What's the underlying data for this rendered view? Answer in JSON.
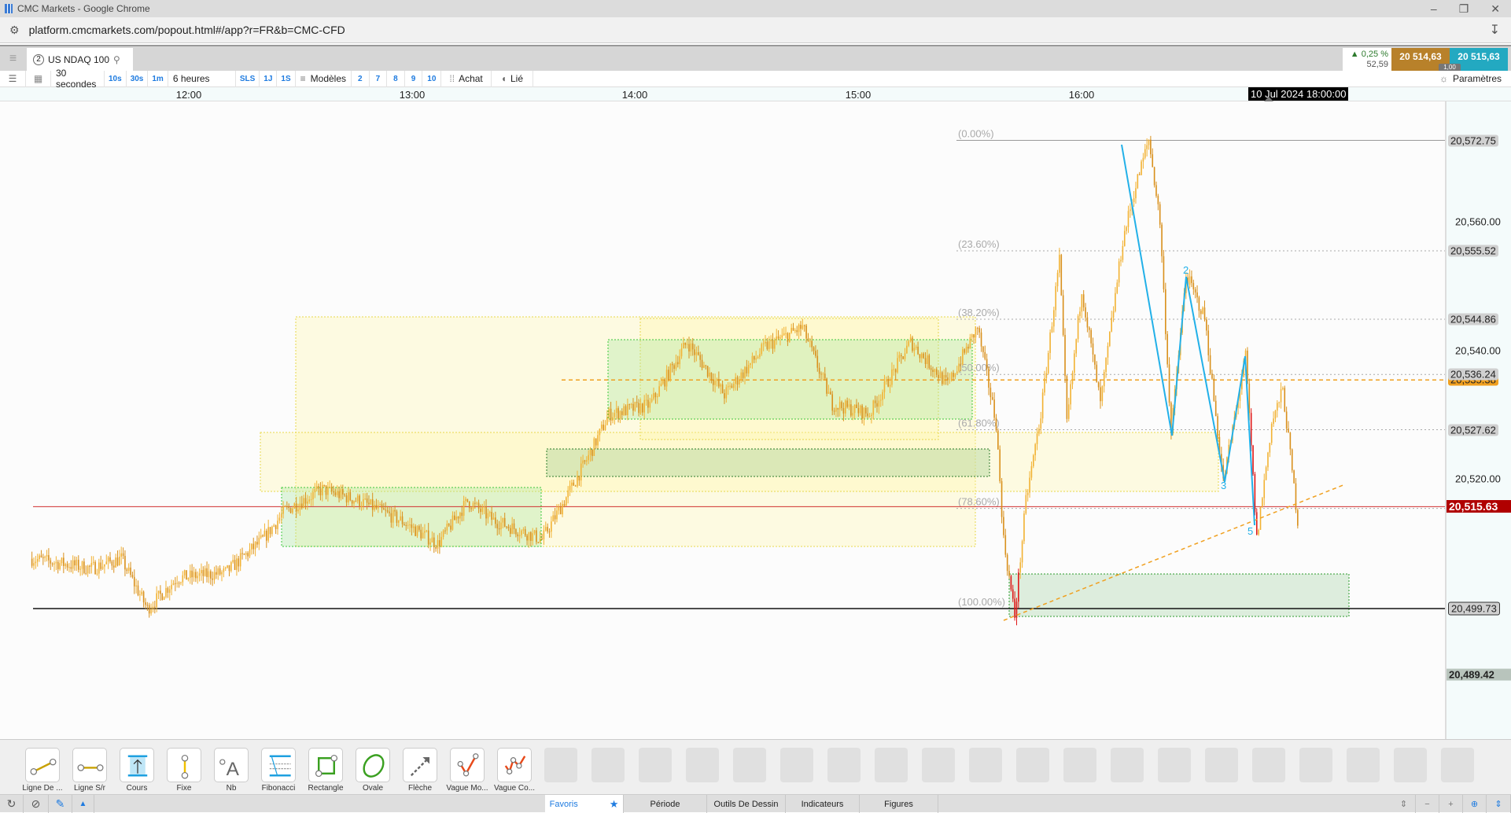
{
  "browser": {
    "title": "CMC Markets - Google Chrome",
    "url": "platform.cmcmarkets.com/popout.html#/app?r=FR&b=CMC-CFD"
  },
  "tab": {
    "number": "2",
    "instrument": "US NDAQ 100"
  },
  "quote": {
    "change_pct": "0,25 %",
    "change_pts": "52,59",
    "sell": "20 514,63",
    "buy": "20 515,63",
    "spread": "1,00",
    "sell_color": "#b8812a",
    "buy_color": "#23a9c1"
  },
  "toolbar": {
    "interval": "30 secondes",
    "quick_intervals": [
      "10s",
      "30s",
      "1m"
    ],
    "range": "6 heures",
    "quick_ranges": [
      "SLS",
      "1J",
      "1S"
    ],
    "templates": "Modèles",
    "template_slots": [
      "2",
      "7",
      "8",
      "9",
      "10"
    ],
    "chart_type": "Achat",
    "link": "Lié",
    "settings": "Paramètres"
  },
  "crosshair_time": "10 Jul 2024 18:00:00",
  "chart_data": {
    "type": "candlestick",
    "instrument": "US NDAQ 100",
    "interval": "30s",
    "x_ticks": [
      "12:00",
      "13:00",
      "14:00",
      "15:00",
      "16:00"
    ],
    "y_ticks": [
      "20,560.00",
      "20,540.00",
      "20,520.00"
    ],
    "ylim": [
      20480.5,
      20583
    ],
    "current_price": 20515.63,
    "current_price_label": "20,515.63",
    "bottom_label": "20,489.42",
    "path_times": [
      "11:09",
      "11:25",
      "11:33",
      "11:40",
      "11:48",
      "12:01",
      "12:11",
      "12:17",
      "12:27",
      "12:37",
      "12:48",
      "12:58",
      "13:06",
      "13:13",
      "13:26",
      "13:32",
      "13:39",
      "13:44",
      "13:55",
      "14:05",
      "14:15",
      "14:26",
      "14:36",
      "14:44",
      "14:54",
      "15:05",
      "15:15",
      "15:23",
      "15:28",
      "15:30",
      "15:33",
      "15:36",
      "15:40",
      "15:45",
      "15:47",
      "15:51",
      "15:56",
      "16:02",
      "16:05",
      "16:09",
      "16:12",
      "16:15",
      "16:19",
      "16:24",
      "16:29",
      "16:35",
      "16:38",
      "16:42",
      "16:45",
      "16:49"
    ],
    "path_prices": [
      20507.5,
      20506.0,
      20507.5,
      20499.7,
      20504.5,
      20505.3,
      20510.5,
      20515.0,
      20518.3,
      20516.5,
      20513.5,
      20509.8,
      20516.5,
      20513.5,
      20510.5,
      20516.5,
      20524.0,
      20530.0,
      20531.5,
      20541.3,
      20533.1,
      20540.6,
      20543.6,
      20531.6,
      20530.1,
      20541.3,
      20534.6,
      20543.6,
      20528.6,
      20510.5,
      20498.5,
      20516.5,
      20530.1,
      20554.1,
      20528.6,
      20549.6,
      20531.6,
      20557.1,
      20564.6,
      20572.9,
      20560.1,
      20527.0,
      20551.8,
      20545.1,
      20519.5,
      20539.1,
      20510.5,
      20528.6,
      20533.8,
      20513.5
    ],
    "fibonacci": [
      {
        "label": "(0.00%)",
        "price": 20572.75,
        "price_label": "20,572.75"
      },
      {
        "label": "(23.60%)",
        "price": 20555.52,
        "price_label": "20,555.52"
      },
      {
        "label": "(38.20%)",
        "price": 20544.86,
        "price_label": "20,544.86"
      },
      {
        "label": "(50.00%)",
        "price": 20536.24,
        "price_label": "20,536.24"
      },
      {
        "label": "(61.80%)",
        "price": 20527.62,
        "price_label": "20,527.62"
      },
      {
        "label": "(78.60%)",
        "price": 20515.35,
        "price_label": ""
      },
      {
        "label": "(100.00%)",
        "price": 20499.73,
        "price_label": "20,499.73"
      }
    ],
    "orange_level": {
      "price": 20535.38,
      "label": "20,535.38"
    },
    "wave_labels": [
      "2",
      "3",
      "5"
    ]
  },
  "tools": [
    "Ligne De ...",
    "Ligne S/r",
    "Cours",
    "Fixe",
    "Nb",
    "Fibonacci",
    "Rectangle",
    "Ovale",
    "Flèche",
    "Vague Mo...",
    "Vague Co..."
  ],
  "bottom_tabs": [
    "Favoris",
    "Période",
    "Outils De Dessin",
    "Indicateurs",
    "Figures"
  ]
}
